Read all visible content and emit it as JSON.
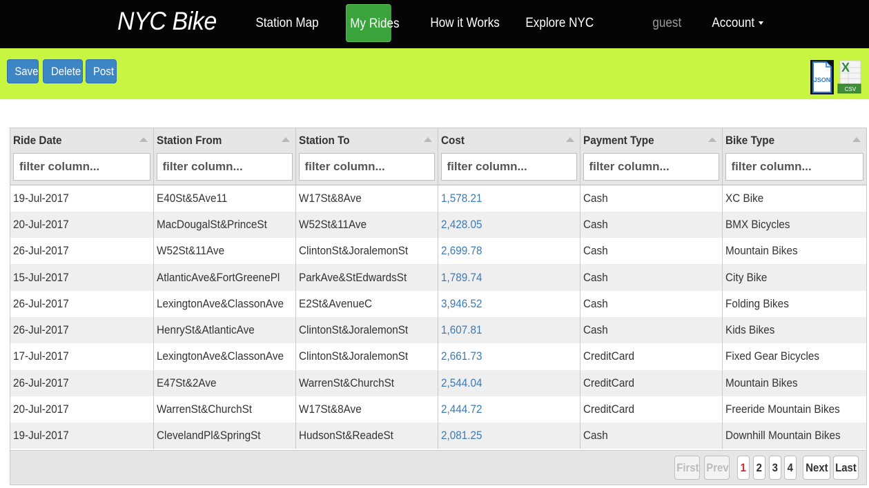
{
  "navbar": {
    "brand": "NYC Bike",
    "items": [
      {
        "label": "Station Map"
      },
      {
        "label": "My Rides"
      },
      {
        "label": "How it Works"
      },
      {
        "label": "Explore NYC"
      },
      {
        "label": "guest"
      },
      {
        "label": "Account"
      }
    ]
  },
  "toolbar": {
    "save": "Save",
    "delete": "Delete",
    "post": "Post",
    "json_icon_text": "JSON",
    "csv_icon_text": "CSV",
    "csv_letter": "X"
  },
  "table": {
    "columns": [
      "Ride Date",
      "Station From",
      "Station To",
      "Cost",
      "Payment Type",
      "Bike Type"
    ],
    "filter_placeholder": "filter column...",
    "rows": [
      [
        "19-Jul-2017",
        "E40St&5Ave11",
        "W17St&8Ave",
        "1,578.21",
        "Cash",
        "XC Bike"
      ],
      [
        "20-Jul-2017",
        "MacDougalSt&PrinceSt",
        "W52St&11Ave",
        "2,428.05",
        "Cash",
        "BMX Bicycles"
      ],
      [
        "26-Jul-2017",
        "W52St&11Ave",
        "ClintonSt&JoralemonSt",
        "2,699.78",
        "Cash",
        "Mountain Bikes"
      ],
      [
        "15-Jul-2017",
        "AtlanticAve&FortGreenePl",
        "ParkAve&StEdwardsSt",
        "1,789.74",
        "Cash",
        "City Bike"
      ],
      [
        "26-Jul-2017",
        "LexingtonAve&ClassonAve",
        "E2St&AvenueC",
        "3,946.52",
        "Cash",
        "Folding Bikes"
      ],
      [
        "26-Jul-2017",
        "HenrySt&AtlanticAve",
        "ClintonSt&JoralemonSt",
        "1,607.81",
        "Cash",
        "Kids Bikes"
      ],
      [
        "17-Jul-2017",
        "LexingtonAve&ClassonAve",
        "ClintonSt&JoralemonSt",
        "2,661.73",
        "CreditCard",
        "Fixed Gear Bicycles"
      ],
      [
        "26-Jul-2017",
        "E47St&2Ave",
        "WarrenSt&ChurchSt",
        "2,544.04",
        "CreditCard",
        "Mountain Bikes"
      ],
      [
        "20-Jul-2017",
        "WarrenSt&ChurchSt",
        "W17St&8Ave",
        "2,444.72",
        "CreditCard",
        "Freeride Mountain Bikes"
      ],
      [
        "19-Jul-2017",
        "ClevelandPl&SpringSt",
        "HudsonSt&ReadeSt",
        "2,081.25",
        "Cash",
        "Downhill Mountain Bikes"
      ]
    ]
  },
  "pager": {
    "first": "First",
    "prev": "Prev",
    "pages": [
      "1",
      "2",
      "3",
      "4"
    ],
    "current_page": "1",
    "next": "Next",
    "last": "Last"
  },
  "colors": {
    "navbar_bg": "#050505",
    "toolbar_bg": "#c8f442",
    "active_nav": "#3aa33c",
    "button_blue": "#3d86c6",
    "cost_link": "#3a7ab8"
  }
}
